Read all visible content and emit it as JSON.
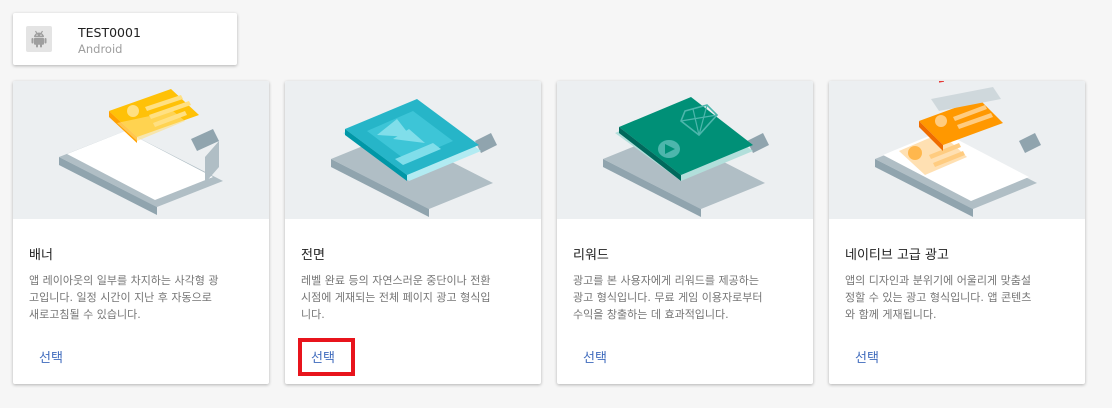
{
  "app": {
    "name": "TEST0001",
    "platform": "Android",
    "icon": "android-icon"
  },
  "ad_formats": [
    {
      "title": "배너",
      "description": "앱 레이아웃의 일부를 차지하는 사각형 광\n고입니다. 일정 시간이 지난 후 자동으로\n새로고침될 수 있습니다.",
      "select_label": "선택",
      "accent": "#ffc107"
    },
    {
      "title": "전면",
      "description": "레벨 완료 등의 자연스러운 중단이나 전환\n시점에 게재되는 전체 페이지 광고 형식입\n니다.",
      "select_label": "선택",
      "accent": "#26b5c8"
    },
    {
      "title": "리워드",
      "description": "광고를 본 사용자에게 리워드를 제공하는\n광고 형식입니다. 무료 게임 이용자로부터\n수익을 창출하는 데 효과적입니다.",
      "select_label": "선택",
      "accent": "#009077"
    },
    {
      "title": "네이티브 고급 광고",
      "description": "앱의 디자인과 분위기에 어울리게 맞춤설\n정할 수 있는 광고 형식입니다. 앱 콘텐츠\n와 함께 게재됩니다.",
      "select_label": "선택",
      "accent": "#ff9800"
    }
  ],
  "colors": {
    "link": "#3f6bbd",
    "highlight": "#e8141c",
    "illustration_bg": "#eceff1"
  }
}
